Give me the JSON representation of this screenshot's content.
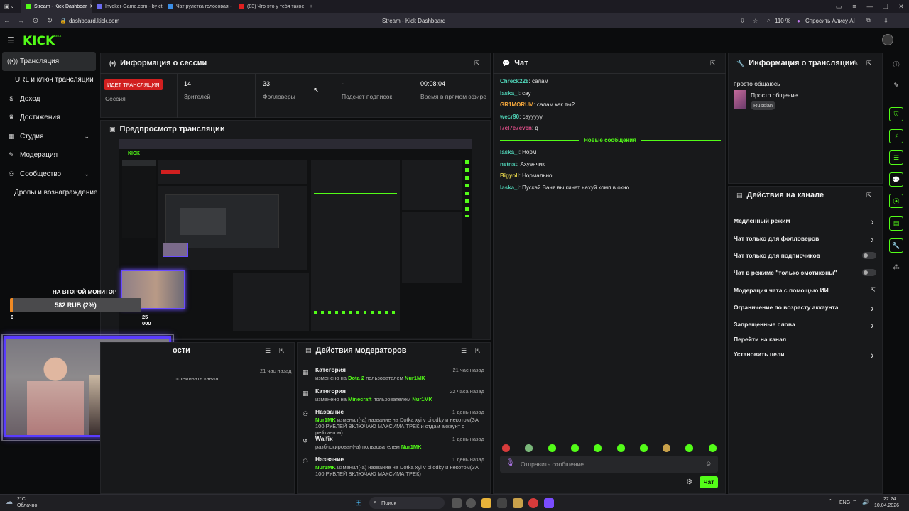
{
  "browser": {
    "tabs": [
      {
        "label": "Stream - Kick Dashboar",
        "active": true,
        "color": "#53fc18"
      },
      {
        "label": "Invoker-Game.com - by ct",
        "active": false,
        "color": "#6a6af0"
      },
      {
        "label": "Чат рулетка голосовая -",
        "active": false,
        "color": "#3a8ee6"
      },
      {
        "label": "(83) Что это у тебя такое",
        "active": false,
        "color": "#e02020"
      }
    ],
    "url": "dashboard.kick.com",
    "page_title": "Stream - Kick Dashboard",
    "zoom": "110 %",
    "alice": "Спросить Алису AI"
  },
  "sidebar": {
    "items": [
      {
        "label": "Трансляция",
        "icon": "((•))"
      },
      {
        "label": "URL и ключ трансляции",
        "icon": ""
      },
      {
        "label": "Доход",
        "icon": "$"
      },
      {
        "label": "Достижения",
        "icon": "🏆"
      },
      {
        "label": "Студия",
        "icon": "▦"
      },
      {
        "label": "Модерация",
        "icon": "🔧"
      },
      {
        "label": "Сообщество",
        "icon": "👥"
      },
      {
        "label": "Дропы и вознаграждение",
        "icon": ""
      }
    ]
  },
  "session": {
    "title": "Информация о сессии",
    "live_badge": "ИДЕТ ТРАНСЛЯЦИЯ",
    "session_label": "Сессия",
    "viewers": "14",
    "viewers_label": "Зрителей",
    "followers": "33",
    "followers_label": "Фолловеры",
    "subs": "-",
    "subs_label": "Подсчет подписок",
    "time": "00:08:04",
    "time_label": "Время в прямом эфире"
  },
  "preview": {
    "title": "Предпросмотр трансляции"
  },
  "overlay": {
    "goal_title": "НА ВТОРОЙ МОНИТОР",
    "goal_progress": "582 RUB (2%)",
    "goal_min": "0",
    "goal_max": "25 000",
    "goal_fraction": 0.02
  },
  "activity": {
    "title": "ости",
    "time": "21 час назад",
    "text": "тслеживать канал"
  },
  "mod_actions": {
    "title": "Действия модераторов",
    "rows": [
      {
        "title": "Категория",
        "time": "21 час назад",
        "pre": "изменено на ",
        "hl1": "Dota 2",
        "mid": " пользователем ",
        "hl2": "Nur1MK",
        "post": ""
      },
      {
        "title": "Категория",
        "time": "22 часа назад",
        "pre": "изменено на ",
        "hl1": "Minecraft",
        "mid": " пользователем ",
        "hl2": "Nur1MK",
        "post": ""
      },
      {
        "title": "Название",
        "time": "1 день назад",
        "pre": "",
        "hl1": "Nur1MK",
        "mid": " изменил(-а) название на Dotka xyi v pilodky и некотом(ЗА 100 РУБЛЕЙ ВКЛЮЧАЮ МАКСИМА ТРЕК и отдам аккаунт с рейтингом)",
        "hl2": "",
        "post": ""
      },
      {
        "title": "Waifix",
        "time": "1 день назад",
        "pre": "разблокирован(-а) пользователем ",
        "hl1": "Nur1MK",
        "mid": "",
        "hl2": "",
        "post": ""
      },
      {
        "title": "Название",
        "time": "1 день назад",
        "pre": "",
        "hl1": "Nur1MK",
        "mid": " изменил(-а) название на Dotka xyi v pilodky и некотом(ЗА 100 РУБЛЕЙ ВКЛЮЧАЮ МАКСИМА ТРЕК)",
        "hl2": "",
        "post": ""
      }
    ]
  },
  "chat": {
    "title": "Чат",
    "messages": [
      {
        "user": "Chreck228",
        "text": "салам",
        "cls": "u-teal"
      },
      {
        "user": "laska_i",
        "text": "сау",
        "cls": "u-teal"
      },
      {
        "user": "GR1MORUM",
        "text": "салам как ты?",
        "cls": "u-orange"
      },
      {
        "user": "wecr90",
        "text": "сауууyy",
        "cls": "u-teal"
      },
      {
        "user": "I7el7e7even",
        "text": "q",
        "cls": "u-pink"
      }
    ],
    "new_messages": "Новые сообщения",
    "new": [
      {
        "user": "laska_i",
        "text": "Норм",
        "cls": "u-teal"
      },
      {
        "user": "netnat",
        "text": "Ахуенчик",
        "cls": "u-teal"
      },
      {
        "user": "Bigyoll",
        "text": "Нормально",
        "cls": "u-yellow"
      },
      {
        "user": "laska_i",
        "text": "Пускай Ваня вы кинет нахуй комп в окно",
        "cls": "u-teal"
      }
    ],
    "placeholder": "Отправить сообщение",
    "send": "Чат"
  },
  "stream_info": {
    "title": "Информация о трансляции",
    "stream_title": "просто общаюсь",
    "category": "Просто общение",
    "language": "Russian"
  },
  "channel_actions": {
    "title": "Действия на канале",
    "items": [
      {
        "label": "Медленный режим",
        "ctrl": "chevron"
      },
      {
        "label": "Чат только для фолловеров",
        "ctrl": "chevron"
      },
      {
        "label": "Чат только для подписчиков",
        "ctrl": "toggle"
      },
      {
        "label": "Чат в режиме \"только эмотиконы\"",
        "ctrl": "toggle"
      },
      {
        "label": "Модерация чата с помощью ИИ",
        "ctrl": "external"
      },
      {
        "label": "Ограничение по возрасту аккаунта",
        "ctrl": "chevron"
      },
      {
        "label": "Запрещенные слова",
        "ctrl": "chevron"
      },
      {
        "label": "Перейти на канал",
        "ctrl": "none"
      },
      {
        "label": "Установить цели",
        "ctrl": "chevron"
      }
    ]
  },
  "taskbar": {
    "weather_temp": "2°C",
    "weather_text": "Облачно",
    "search": "Поиск",
    "lang": "ENG",
    "time": "22:24",
    "date": "10.04.2026"
  }
}
